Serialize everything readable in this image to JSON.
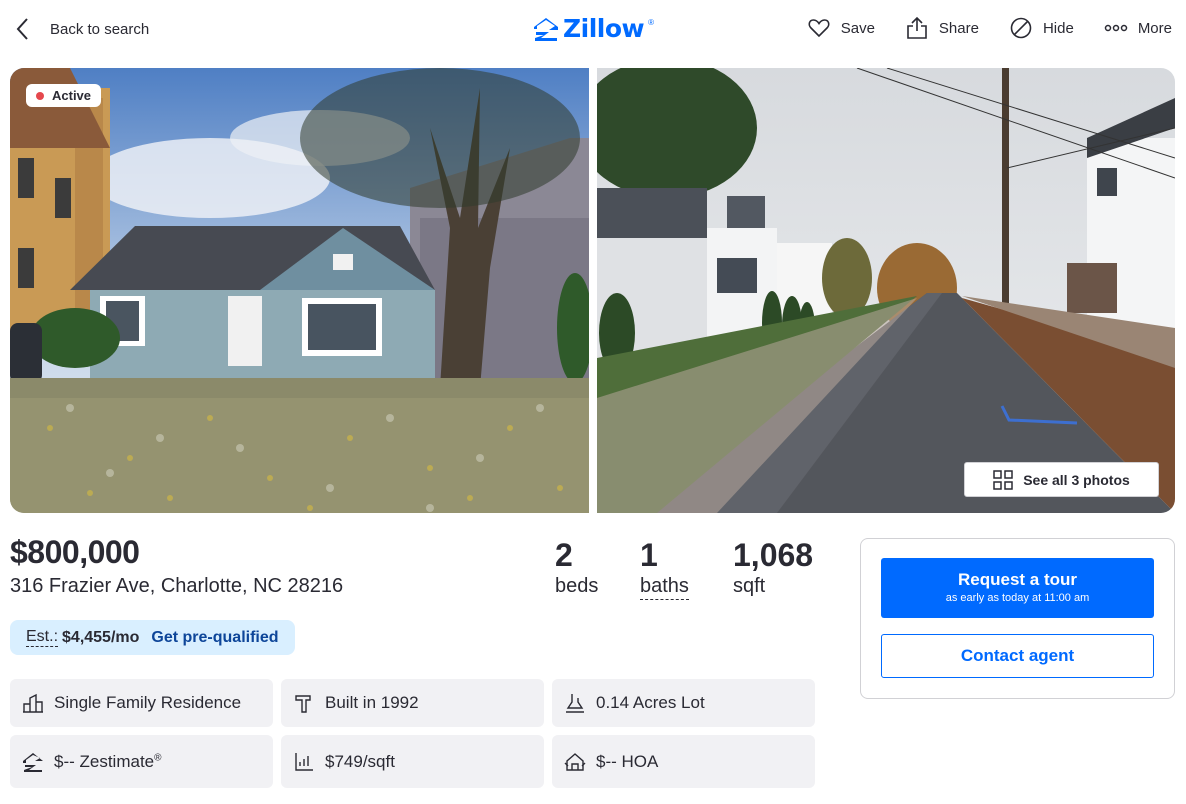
{
  "header": {
    "back_label": "Back to search",
    "logo_text": "Zillow",
    "logo_reg": "®",
    "actions": [
      {
        "label": "Save",
        "icon": "heart-icon"
      },
      {
        "label": "Share",
        "icon": "share-icon"
      },
      {
        "label": "Hide",
        "icon": "hide-icon"
      },
      {
        "label": "More",
        "icon": "more-icon"
      }
    ]
  },
  "photos": {
    "status_badge": "Active",
    "see_all_label": "See all 3 photos"
  },
  "listing": {
    "price": "$800,000",
    "address": "316 Frazier Ave, Charlotte, NC 28216",
    "beds": {
      "value": "2",
      "label": "beds"
    },
    "baths": {
      "value": "1",
      "label": "baths"
    },
    "sqft": {
      "value": "1,068",
      "label": "sqft"
    },
    "estimate": {
      "label": "Est.:",
      "value": "$4,455/mo",
      "link": "Get pre-qualified"
    },
    "facts": [
      {
        "text": "Single Family Residence",
        "icon": "home-type-icon"
      },
      {
        "text": "Built in 1992",
        "icon": "hammer-icon"
      },
      {
        "text": "0.14 Acres Lot",
        "icon": "lot-size-icon"
      },
      {
        "text": "$-- Zestimate",
        "sup": "®",
        "icon": "zestimate-icon"
      },
      {
        "text": "$749/sqft",
        "icon": "price-per-sqft-icon"
      },
      {
        "text": "$-- HOA",
        "icon": "hoa-icon"
      }
    ]
  },
  "tour": {
    "request_label": "Request a tour",
    "request_sub": "as early as today at 11:00 am",
    "contact_label": "Contact agent"
  },
  "colors": {
    "brand": "#006aff",
    "text": "#2a2a33",
    "active_dot": "#e5484d",
    "est_bg": "#d9efff",
    "fact_bg": "#f1f1f4"
  }
}
